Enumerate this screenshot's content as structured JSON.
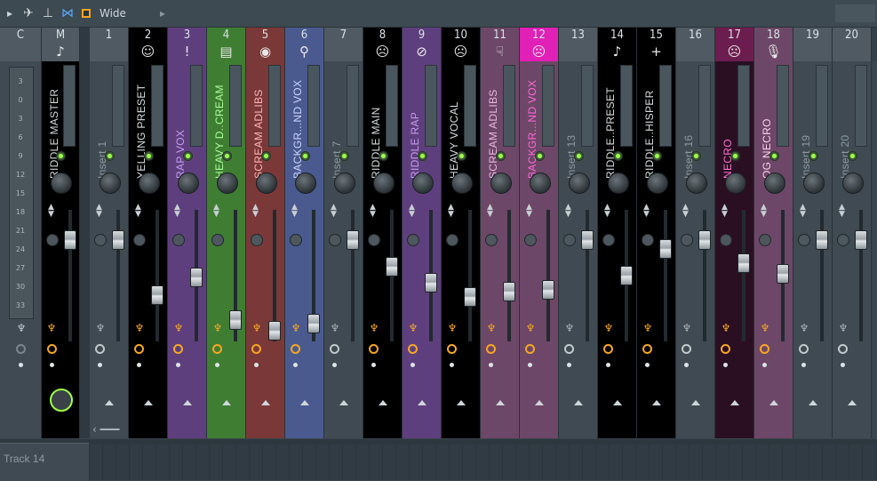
{
  "toolbar": {
    "preset_label": "Wide"
  },
  "master_header": {
    "current": "C",
    "master": "M"
  },
  "meter_scale": [
    "3",
    "0",
    "3",
    "6",
    "9",
    "12",
    "15",
    "18",
    "21",
    "24",
    "27",
    "30",
    "33"
  ],
  "channels": [
    {
      "num": "1",
      "name": "Insert 1",
      "icon": "none-icon",
      "glyph": ""
    },
    {
      "num": "2",
      "name": "YELLING PRESET",
      "icon": "smiley-icon",
      "glyph": "☺"
    },
    {
      "num": "3",
      "name": "RAP VOX",
      "icon": "exclamation-icon",
      "glyph": "!"
    },
    {
      "num": "4",
      "name": "HEAVY D..CREAM",
      "icon": "ladder-icon",
      "glyph": "▤"
    },
    {
      "num": "5",
      "name": "SCREAM ADLIBS",
      "icon": "eye-icon",
      "glyph": "◉"
    },
    {
      "num": "6",
      "name": "BACKGR...ND VOX",
      "icon": "microphone-icon",
      "glyph": "⚲"
    },
    {
      "num": "7",
      "name": "Insert 7",
      "icon": "none-icon",
      "glyph": ""
    },
    {
      "num": "8",
      "name": "RIDDLE MAIN",
      "icon": "sad-face-icon",
      "glyph": "☹"
    },
    {
      "num": "9",
      "name": "RIDDLE RAP",
      "icon": "prohibited-icon",
      "glyph": "⊘"
    },
    {
      "num": "10",
      "name": "HEAVY VOCAL",
      "icon": "sad-face-icon",
      "glyph": "☹"
    },
    {
      "num": "11",
      "name": "SCREAM ADLIBS",
      "icon": "thumbs-down-icon",
      "glyph": "☟"
    },
    {
      "num": "12",
      "name": "BACKGR...ND VOX",
      "icon": "sad-face-icon",
      "glyph": "☹"
    },
    {
      "num": "13",
      "name": "Insert 13",
      "icon": "none-icon",
      "glyph": ""
    },
    {
      "num": "14",
      "name": "RIDDLE..PRESET",
      "icon": "music-note-icon",
      "glyph": "♪"
    },
    {
      "num": "15",
      "name": "RIDDLE..HISPER",
      "icon": "plus-icon",
      "glyph": "+"
    },
    {
      "num": "16",
      "name": "Insert 16",
      "icon": "none-icon",
      "glyph": ""
    },
    {
      "num": "17",
      "name": "NECRO",
      "icon": "sad-face-icon",
      "glyph": "☹"
    },
    {
      "num": "18",
      "name": "OG NECRO",
      "icon": "microphone-icon",
      "glyph": "🎙"
    },
    {
      "num": "19",
      "name": "Insert 19",
      "icon": "none-icon",
      "glyph": ""
    },
    {
      "num": "20",
      "name": "Insert 20",
      "icon": "none-icon",
      "glyph": ""
    }
  ],
  "master": {
    "name": "RIDDLE MASTER",
    "icon": "music-note-icon",
    "glyph": "♪"
  },
  "playlist": {
    "track_label": "Track 14"
  },
  "colors": {
    "green": "#3f7d33",
    "red": "#7a3838",
    "purple": "#5e3f7d",
    "blue": "#4a5a8f",
    "pink": "#e020b6",
    "maroon": "#6c1d4f",
    "black": "#000000",
    "accent_led": "#9cff4a"
  }
}
